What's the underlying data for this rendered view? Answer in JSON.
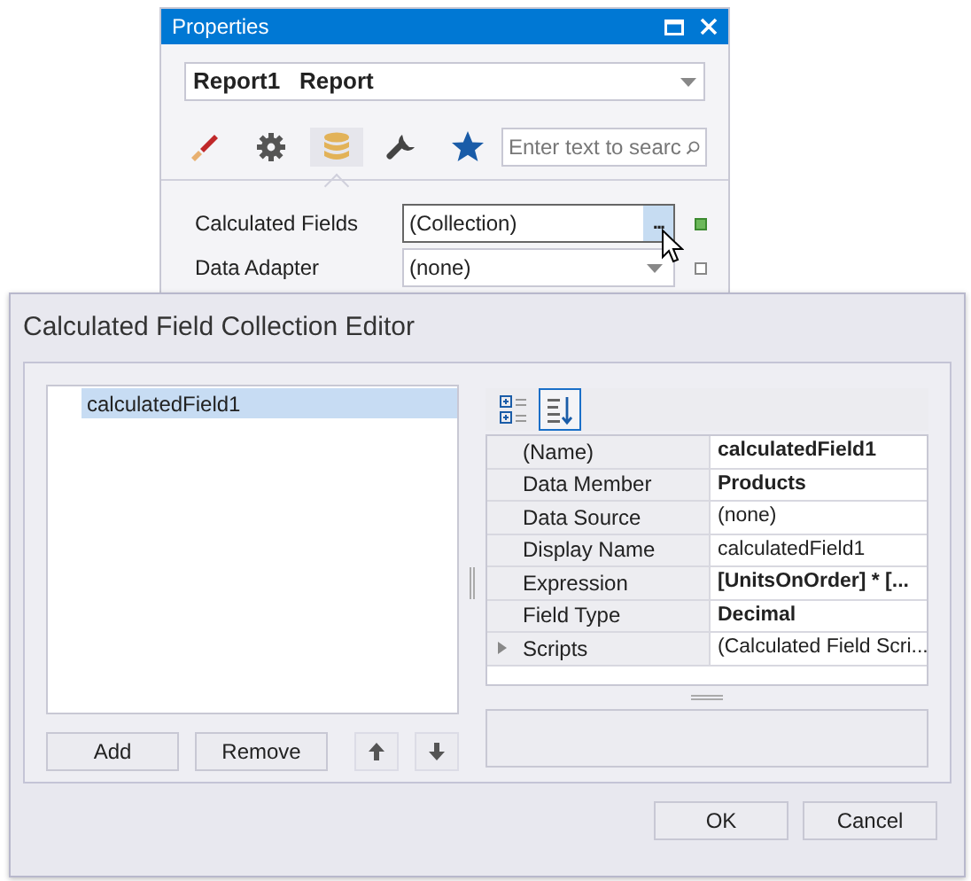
{
  "properties": {
    "title": "Properties",
    "object_selector": {
      "name": "Report1",
      "type": "Report"
    },
    "tabs": [
      {
        "kind": "appearance",
        "selected": false
      },
      {
        "kind": "behavior",
        "selected": false
      },
      {
        "kind": "data",
        "selected": true
      },
      {
        "kind": "design",
        "selected": false
      },
      {
        "kind": "favorites",
        "selected": false
      }
    ],
    "search": {
      "placeholder": "Enter text to searc"
    },
    "rows": [
      {
        "label": "Calculated Fields",
        "value": "(Collection)",
        "kind": "ellipsis",
        "button": "...",
        "modified": true
      },
      {
        "label": "Data Adapter",
        "value": "(none)",
        "kind": "dropdown",
        "modified": false
      }
    ]
  },
  "dialog": {
    "title": "Calculated Field Collection Editor",
    "items": [
      {
        "text": "calculatedField1",
        "selected": true
      }
    ],
    "list_buttons": [
      "Add",
      "Remove"
    ],
    "sort_buttons": [
      {
        "kind": "categorized",
        "selected": false
      },
      {
        "kind": "alphabetical",
        "selected": true
      }
    ],
    "grid_rows": [
      {
        "name": "(Name)",
        "value": "calculatedField1",
        "kind": "property",
        "modified": true
      },
      {
        "name": "Data Member",
        "value": "Products",
        "kind": "property",
        "modified": true
      },
      {
        "name": "Data Source",
        "value": "(none)",
        "kind": "property",
        "modified": false
      },
      {
        "name": "Display Name",
        "value": "calculatedField1",
        "kind": "property",
        "modified": false
      },
      {
        "name": "Expression",
        "value": "[UnitsOnOrder] * [...",
        "kind": "property",
        "modified": true
      },
      {
        "name": "Field Type",
        "value": "Decimal",
        "kind": "property",
        "modified": true
      },
      {
        "name": "Scripts",
        "value": "(Calculated Field Scri...",
        "kind": "group",
        "expanded": false,
        "modified": false
      }
    ],
    "footer_buttons": [
      "OK",
      "Cancel"
    ]
  }
}
